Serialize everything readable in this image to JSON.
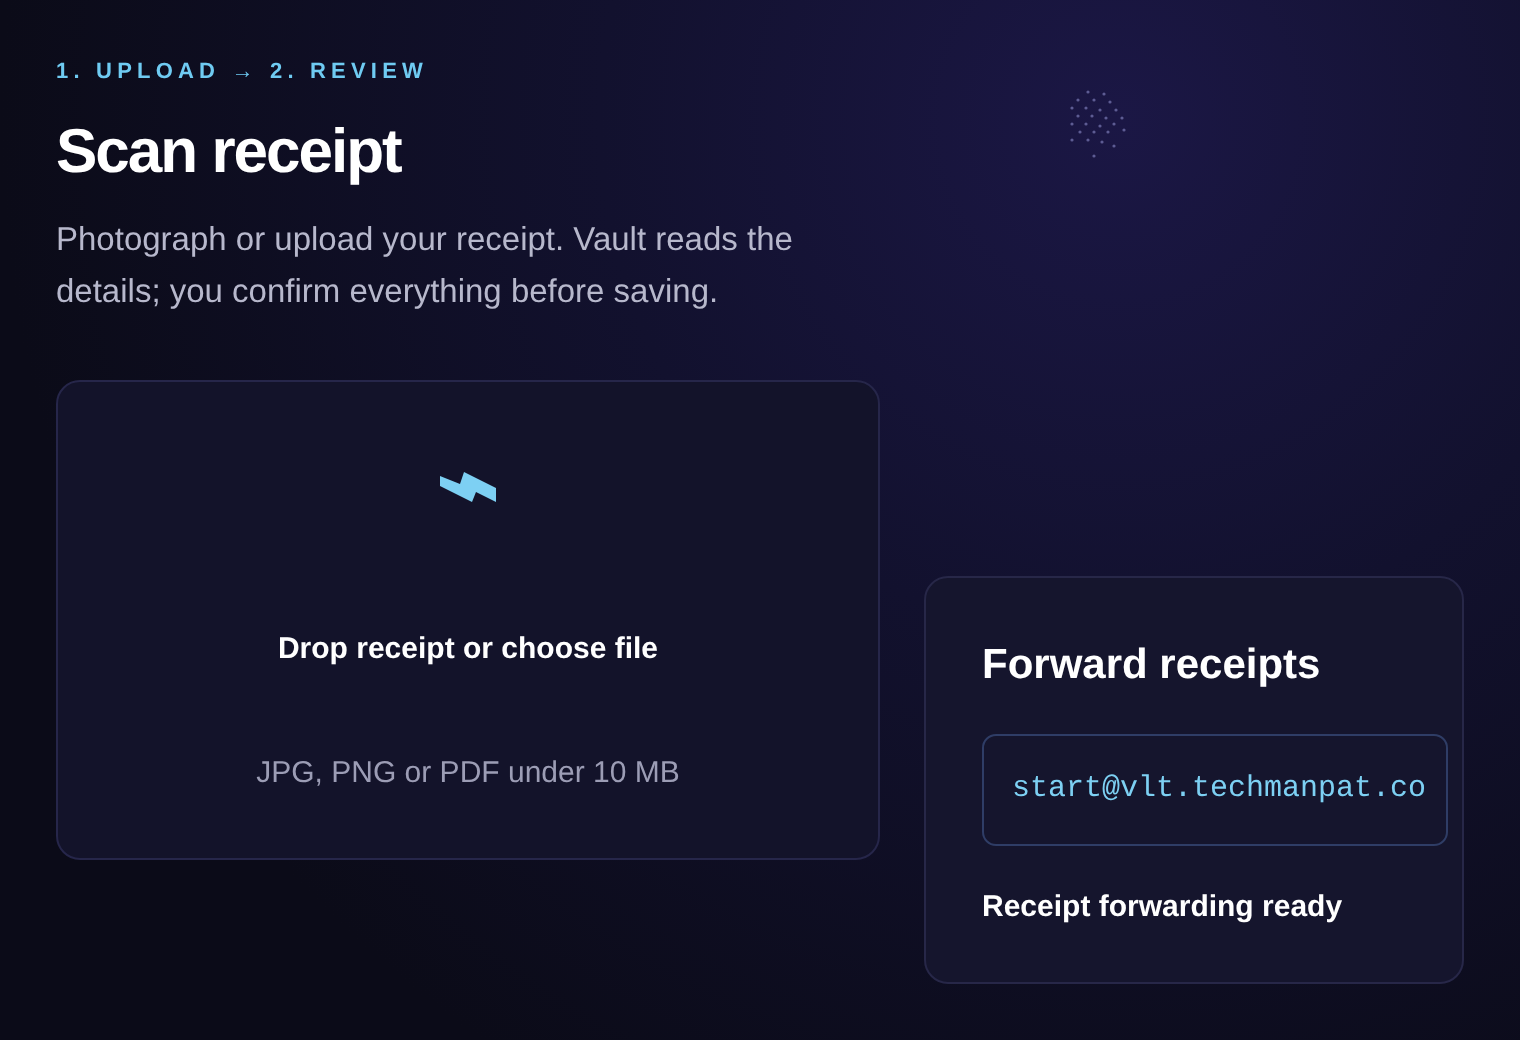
{
  "steps": "1. UPLOAD → 2. REVIEW",
  "title": "Scan receipt",
  "intro": "Photograph or upload your receipt. Vault reads the details; you confirm everything before saving.",
  "dropzone": {
    "label": "Drop receipt or choose file",
    "hint": "JPG, PNG or PDF under 10 MB"
  },
  "forward": {
    "title": "Forward receipts",
    "address": "start@vlt.techmanpat.co",
    "status": "Receipt forwarding ready"
  }
}
